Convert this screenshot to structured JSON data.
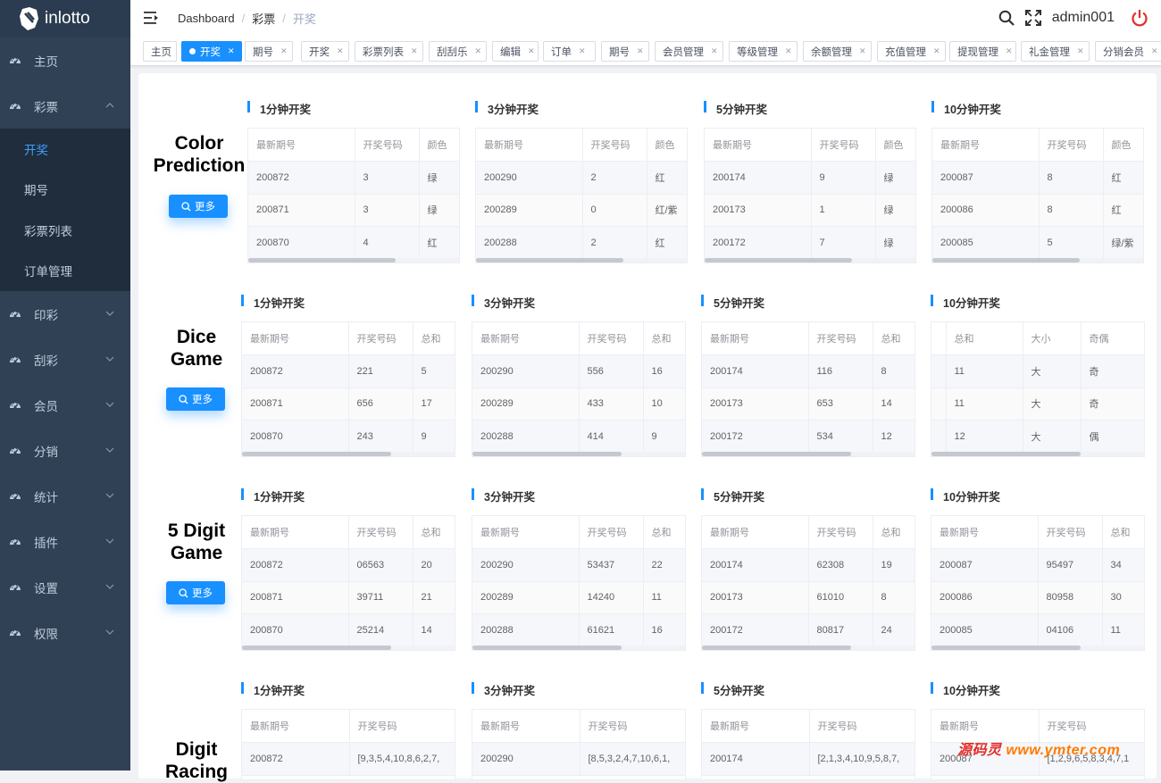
{
  "app": {
    "logo_text": "inlotto"
  },
  "sidebar": {
    "items": [
      {
        "label": "主页",
        "icon": "dashboard-icon",
        "expandable": false
      },
      {
        "label": "彩票",
        "icon": "dashboard-icon",
        "expandable": true,
        "open": true,
        "children": [
          {
            "label": "开奖",
            "active": true
          },
          {
            "label": "期号"
          },
          {
            "label": "彩票列表"
          },
          {
            "label": "订单管理"
          }
        ]
      },
      {
        "label": "印彩",
        "icon": "dashboard-icon",
        "expandable": true
      },
      {
        "label": "刮彩",
        "icon": "dashboard-icon",
        "expandable": true
      },
      {
        "label": "会员",
        "icon": "dashboard-icon",
        "expandable": true
      },
      {
        "label": "分销",
        "icon": "dashboard-icon",
        "expandable": true
      },
      {
        "label": "统计",
        "icon": "dashboard-icon",
        "expandable": true
      },
      {
        "label": "插件",
        "icon": "dashboard-icon",
        "expandable": true
      },
      {
        "label": "设置",
        "icon": "dashboard-icon",
        "expandable": true
      },
      {
        "label": "权限",
        "icon": "dashboard-icon",
        "expandable": true
      }
    ]
  },
  "navbar": {
    "breadcrumb": [
      "Dashboard",
      "彩票",
      "开奖"
    ],
    "username": "admin001",
    "icons": [
      "hamburger-icon",
      "search-icon",
      "fullscreen-icon",
      "power-icon"
    ]
  },
  "tags": [
    "主页",
    "开奖",
    "期号",
    "开奖",
    "彩票列表",
    "刮刮乐",
    "编辑",
    "订单",
    "期号",
    "会员管理",
    "等级管理",
    "余额管理",
    "充值管理",
    "提现管理",
    "礼金管理",
    "分销会员"
  ],
  "active_tag_index": 1,
  "more_button_label": "更多",
  "games": [
    {
      "name": [
        "Color",
        "Prediction"
      ],
      "sections": [
        {
          "title": "1分钟开奖",
          "headers": [
            "最新期号",
            "开奖号码",
            "颜色"
          ],
          "rows": [
            [
              "200872",
              "3",
              "绿"
            ],
            [
              "200871",
              "3",
              "绿"
            ],
            [
              "200870",
              "4",
              "红"
            ]
          ]
        },
        {
          "title": "3分钟开奖",
          "headers": [
            "最新期号",
            "开奖号码",
            "颜色"
          ],
          "rows": [
            [
              "200290",
              "2",
              "红"
            ],
            [
              "200289",
              "0",
              "红/紫"
            ],
            [
              "200288",
              "2",
              "红"
            ]
          ]
        },
        {
          "title": "5分钟开奖",
          "headers": [
            "最新期号",
            "开奖号码",
            "颜色"
          ],
          "rows": [
            [
              "200174",
              "9",
              "绿"
            ],
            [
              "200173",
              "1",
              "绿"
            ],
            [
              "200172",
              "7",
              "绿"
            ]
          ]
        },
        {
          "title": "10分钟开奖",
          "headers": [
            "最新期号",
            "开奖号码",
            "颜色"
          ],
          "rows": [
            [
              "200087",
              "8",
              "红"
            ],
            [
              "200086",
              "8",
              "红"
            ],
            [
              "200085",
              "5",
              "绿/紫"
            ]
          ]
        }
      ]
    },
    {
      "name": [
        "Dice",
        "Game"
      ],
      "sections": [
        {
          "title": "1分钟开奖",
          "headers": [
            "最新期号",
            "开奖号码",
            "总和"
          ],
          "rows": [
            [
              "200872",
              "221",
              "5"
            ],
            [
              "200871",
              "656",
              "17"
            ],
            [
              "200870",
              "243",
              "9"
            ]
          ]
        },
        {
          "title": "3分钟开奖",
          "headers": [
            "最新期号",
            "开奖号码",
            "总和"
          ],
          "rows": [
            [
              "200290",
              "556",
              "16"
            ],
            [
              "200289",
              "433",
              "10"
            ],
            [
              "200288",
              "414",
              "9"
            ]
          ]
        },
        {
          "title": "5分钟开奖",
          "headers": [
            "最新期号",
            "开奖号码",
            "总和"
          ],
          "rows": [
            [
              "200174",
              "116",
              "8"
            ],
            [
              "200173",
              "653",
              "14"
            ],
            [
              "200172",
              "534",
              "12"
            ]
          ]
        },
        {
          "title": "10分钟开奖",
          "headers": [
            "",
            "总和",
            "大小",
            "奇偶"
          ],
          "rows": [
            [
              "",
              "11",
              "大",
              "奇"
            ],
            [
              "",
              "11",
              "大",
              "奇"
            ],
            [
              "",
              "12",
              "大",
              "偶"
            ]
          ]
        }
      ]
    },
    {
      "name": [
        "5 Digit",
        "Game"
      ],
      "sections": [
        {
          "title": "1分钟开奖",
          "headers": [
            "最新期号",
            "开奖号码",
            "总和"
          ],
          "rows": [
            [
              "200872",
              "06563",
              "20"
            ],
            [
              "200871",
              "39711",
              "21"
            ],
            [
              "200870",
              "25214",
              "14"
            ]
          ]
        },
        {
          "title": "3分钟开奖",
          "headers": [
            "最新期号",
            "开奖号码",
            "总和"
          ],
          "rows": [
            [
              "200290",
              "53437",
              "22"
            ],
            [
              "200289",
              "14240",
              "11"
            ],
            [
              "200288",
              "61621",
              "16"
            ]
          ]
        },
        {
          "title": "5分钟开奖",
          "headers": [
            "最新期号",
            "开奖号码",
            "总和"
          ],
          "rows": [
            [
              "200174",
              "62308",
              "19"
            ],
            [
              "200173",
              "61010",
              "8"
            ],
            [
              "200172",
              "80817",
              "24"
            ]
          ]
        },
        {
          "title": "10分钟开奖",
          "headers": [
            "最新期号",
            "开奖号码",
            "总和"
          ],
          "rows": [
            [
              "200087",
              "95497",
              "34"
            ],
            [
              "200086",
              "80958",
              "30"
            ],
            [
              "200085",
              "04106",
              "11"
            ]
          ]
        }
      ]
    },
    {
      "name": [
        "Digit",
        "Racing"
      ],
      "sections": [
        {
          "title": "1分钟开奖",
          "headers": [
            "最新期号",
            "开奖号码"
          ],
          "rows": [
            [
              "200872",
              "[9,3,5,4,10,8,6,2,7,"
            ]
          ]
        },
        {
          "title": "3分钟开奖",
          "headers": [
            "最新期号",
            "开奖号码"
          ],
          "rows": [
            [
              "200290",
              "[8,5,3,2,4,7,10,6,1,"
            ]
          ]
        },
        {
          "title": "5分钟开奖",
          "headers": [
            "最新期号",
            "开奖号码"
          ],
          "rows": [
            [
              "200174",
              "[2,1,3,4,10,9,5,8,7,"
            ]
          ]
        },
        {
          "title": "10分钟开奖",
          "headers": [
            "最新期号",
            "开奖号码"
          ],
          "rows": [
            [
              "200087",
              "[1,2,9,6,5,8,3,4,7,1"
            ]
          ]
        }
      ]
    }
  ],
  "watermark": {
    "brand": "源码灵",
    "url": "www.ymter.com"
  }
}
